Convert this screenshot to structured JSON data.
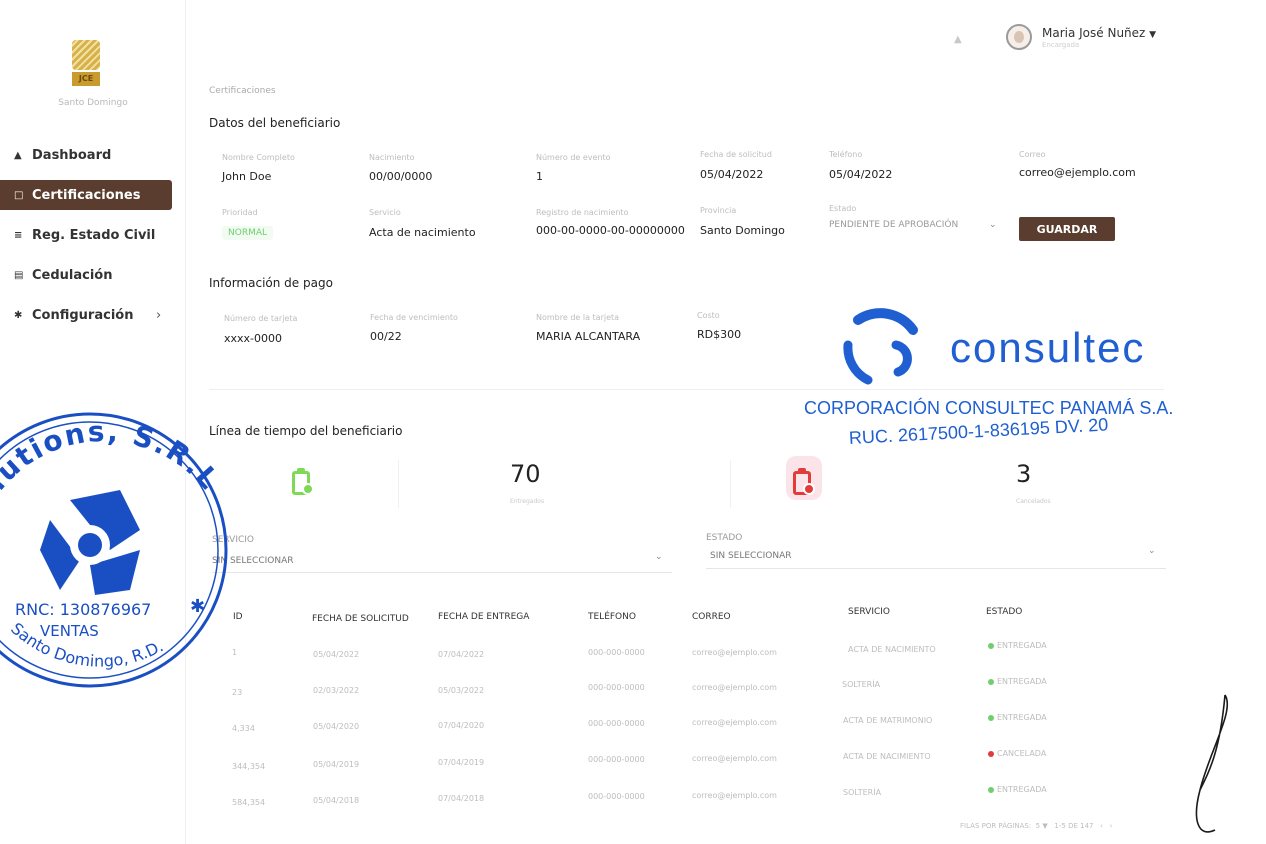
{
  "sidebar": {
    "logo_text": "JCE",
    "org_name": "Santo Domingo",
    "items": [
      {
        "label": "Dashboard",
        "icon": "home-icon"
      },
      {
        "label": "Certificaciones",
        "icon": "document-icon",
        "active": true
      },
      {
        "label": "Reg. Estado Civil",
        "icon": "registry-icon"
      },
      {
        "label": "Cedulación",
        "icon": "id-card-icon"
      },
      {
        "label": "Configuración",
        "icon": "gear-icon",
        "has_submenu": true
      }
    ]
  },
  "header": {
    "user_name": "Maria José Nuñez",
    "user_role": "Encargada",
    "notification_icon": "bell-icon"
  },
  "breadcrumb": "Certificaciones",
  "beneficiary": {
    "title": "Datos del beneficiario",
    "fields": [
      {
        "label": "Nombre Completo",
        "value": "John Doe"
      },
      {
        "label": "Nacimiento",
        "value": "00/00/0000"
      },
      {
        "label": "Número de evento",
        "value": "1"
      },
      {
        "label": "Fecha de solicitud",
        "value": "05/04/2022"
      },
      {
        "label": "Teléfono",
        "value": "05/04/2022"
      },
      {
        "label": "Correo",
        "value": "correo@ejemplo.com"
      },
      {
        "label": "Prioridad",
        "value": "NORMAL"
      },
      {
        "label": "Servicio",
        "value": "Acta de nacimiento"
      },
      {
        "label": "Registro de nacimiento",
        "value": "000-00-0000-00-00000000"
      },
      {
        "label": "Provincia",
        "value": "Santo Domingo"
      },
      {
        "label": "Estado",
        "value": "PENDIENTE DE APROBACIÓN"
      }
    ],
    "save_label": "GUARDAR"
  },
  "payment": {
    "title": "Información de pago",
    "fields": [
      {
        "label": "Número de tarjeta",
        "value": "xxxx-0000"
      },
      {
        "label": "Fecha de vencimiento",
        "value": "00/22"
      },
      {
        "label": "Nombre de la tarjeta",
        "value": "MARIA ALCANTARA"
      },
      {
        "label": "Costo",
        "value": "RD$300"
      }
    ]
  },
  "timeline": {
    "title": "Línea de tiempo del beneficiario",
    "delivered_count": "70",
    "delivered_caption": "Entregados",
    "cancelled_count": "3",
    "cancelled_caption": "Cancelados"
  },
  "filters": {
    "service_label": "SERVICIO",
    "service_value": "SIN SELECCIONAR",
    "status_label": "ESTADO",
    "status_value": "SIN SELECCIONAR"
  },
  "table": {
    "headers": [
      "ID",
      "FECHA DE SOLICITUD",
      "FECHA DE ENTREGA",
      "TELÉFONO",
      "CORREO",
      "SERVICIO",
      "ESTADO"
    ],
    "rows": [
      {
        "id": "1",
        "solicitud": "05/04/2022",
        "entrega": "07/04/2022",
        "telefono": "000-000-0000",
        "correo": "correo@ejemplo.com",
        "servicio": "ACTA DE NACIMIENTO",
        "estado": "ENTREGADA",
        "status": "ok"
      },
      {
        "id": "23",
        "solicitud": "02/03/2022",
        "entrega": "05/03/2022",
        "telefono": "000-000-0000",
        "correo": "correo@ejemplo.com",
        "servicio": "SOLTERÍA",
        "estado": "ENTREGADA",
        "status": "ok"
      },
      {
        "id": "4,334",
        "solicitud": "05/04/2020",
        "entrega": "07/04/2020",
        "telefono": "000-000-0000",
        "correo": "correo@ejemplo.com",
        "servicio": "ACTA DE MATRIMONIO",
        "estado": "ENTREGADA",
        "status": "ok"
      },
      {
        "id": "344,354",
        "solicitud": "05/04/2019",
        "entrega": "07/04/2019",
        "telefono": "000-000-0000",
        "correo": "correo@ejemplo.com",
        "servicio": "ACTA DE NACIMIENTO",
        "estado": "CANCELADA",
        "status": "cancel"
      },
      {
        "id": "584,354",
        "solicitud": "05/04/2018",
        "entrega": "07/04/2018",
        "telefono": "000-000-0000",
        "correo": "correo@ejemplo.com",
        "servicio": "SOLTERÍA",
        "estado": "ENTREGADA",
        "status": "ok"
      }
    ],
    "rows_per_page_label": "FILAS POR PÁGINAS:",
    "rows_per_page": "5",
    "range": "1-5 DE 147"
  },
  "watermark": {
    "brand": "consultec",
    "corporation": "CORPORACIÓN CONSULTEC PANAMÁ S.A.",
    "ruc": "RUC. 2617500-1-836195 DV. 20"
  },
  "stamp": {
    "company": "Solutions, S.R.L.",
    "rnc": "RNC: 130876967",
    "dept": "VENTAS",
    "city": "Santo Domingo, R.D."
  },
  "colors": {
    "accent": "#5a3d2e",
    "ok": "#6fcf6f",
    "cancel": "#e23b3b",
    "consultec": "#1f5fd1",
    "stamp": "#1a4fc4"
  }
}
